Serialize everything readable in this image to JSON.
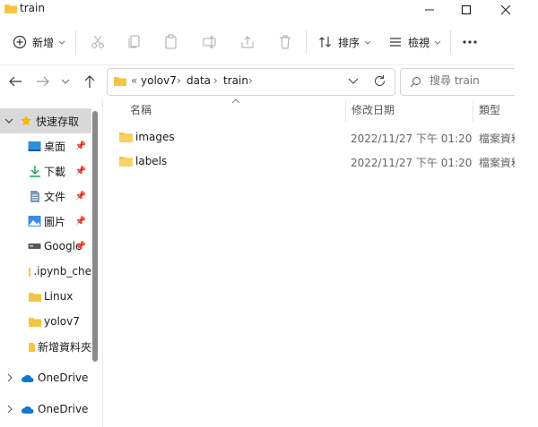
{
  "window": {
    "title": "train"
  },
  "toolbar": {
    "new_label": "新增",
    "sort_label": "排序",
    "view_label": "檢視"
  },
  "address": {
    "overflow": "«",
    "crumbs": [
      "yolov7",
      "data",
      "train"
    ]
  },
  "search": {
    "placeholder": "搜尋 train"
  },
  "nav": {
    "quick_access": "快速存取",
    "items": [
      {
        "label": "桌面",
        "icon": "desktop-icon",
        "pinned": true
      },
      {
        "label": "下載",
        "icon": "download-icon",
        "pinned": true
      },
      {
        "label": "文件",
        "icon": "document-icon",
        "pinned": true
      },
      {
        "label": "圖片",
        "icon": "picture-icon",
        "pinned": true
      },
      {
        "label": "Google",
        "icon": "drive-icon",
        "pinned": true
      },
      {
        "label": ".ipynb_che",
        "icon": "folder-icon",
        "pinned": false
      },
      {
        "label": "Linux",
        "icon": "folder-icon",
        "pinned": false
      },
      {
        "label": "yolov7",
        "icon": "folder-icon",
        "pinned": false
      },
      {
        "label": "新增資料夾",
        "icon": "folder-icon",
        "pinned": false
      }
    ],
    "onedrive": [
      "OneDrive",
      "OneDrive"
    ]
  },
  "columns": {
    "name": "名稱",
    "date": "修改日期",
    "type": "類型"
  },
  "files": [
    {
      "name": "images",
      "date": "2022/11/27 下午 01:20",
      "type": "檔案資料"
    },
    {
      "name": "labels",
      "date": "2022/11/27 下午 01:20",
      "type": "檔案資料"
    }
  ],
  "colors": {
    "folder": "#f5c542",
    "accent": "#0067c0",
    "selected": "#d9d9d9"
  }
}
